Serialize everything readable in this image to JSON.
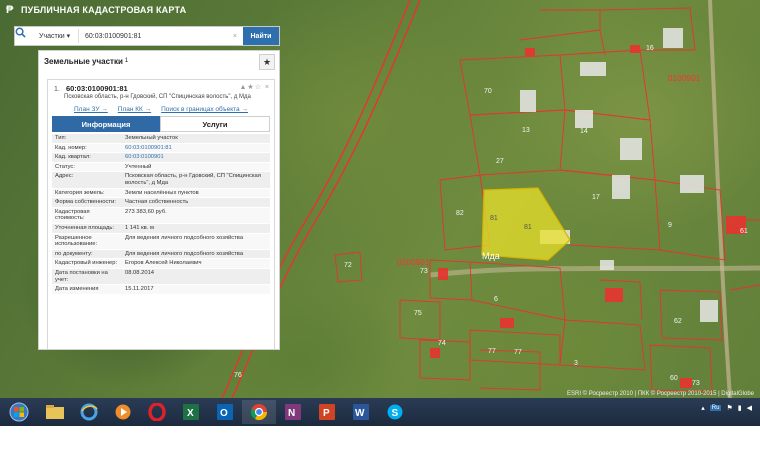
{
  "app": {
    "title": "ПУБЛИЧНАЯ КАДАСТРОВАЯ КАРТА"
  },
  "search": {
    "type_label": "Участки",
    "query": "60:03:0100901:81",
    "find_label": "Найти"
  },
  "panel": {
    "title": "Земельные участки",
    "count": "1",
    "result": {
      "index": "1.",
      "cad_number": "60:03:0100901:81",
      "address": "Псковская область, р-н Гдовский, СП \"Спицинская волость\", д Мда",
      "links": [
        "План ЗУ →",
        "План КК →",
        "Поиск в границах объекта →"
      ],
      "tabs": [
        "Информация",
        "Услуги"
      ],
      "attributes": [
        {
          "key": "Тип:",
          "value": "Земельный участок"
        },
        {
          "key": "Кад. номер:",
          "value": "60:03:0100901:81",
          "link": true
        },
        {
          "key": "Кад. квартал:",
          "value": "60:03:0100901",
          "link": true
        },
        {
          "key": "Статус:",
          "value": "Учтенный"
        },
        {
          "key": "Адрес:",
          "value": "Псковская область, р-н Гдовский, СП \"Спицинская волость\", д Мда"
        },
        {
          "key": "Категория земель:",
          "value": "Земли населённых пунктов"
        },
        {
          "key": "Форма собственности:",
          "value": "Частная собственность"
        },
        {
          "key": "Кадастровая стоимость:",
          "value": "273 383,60 руб."
        },
        {
          "key": "Уточненная площадь:",
          "value": "1 141 кв. м"
        },
        {
          "key": "Разрешенное использование:",
          "value": "Для ведения личного подсобного хозяйства"
        },
        {
          "key": "по документу:",
          "value": "Для ведения личного подсобного хозяйства"
        },
        {
          "key": "Кадастровый инженер:",
          "value": "Егоров Алексей Николаевич"
        },
        {
          "key": "Дата постановки на учет:",
          "value": "08.08.2014"
        },
        {
          "key": "Дата изменения",
          "value": "15.11.2017"
        }
      ]
    }
  },
  "map": {
    "quarter_labels": [
      "0100901",
      "0100901"
    ],
    "village": "Мда",
    "parcel_numbers": [
      "70",
      "16",
      "13",
      "14",
      "27",
      "17",
      "81",
      "82",
      "81",
      "9",
      "72",
      "73",
      "75",
      "74",
      "77",
      "77",
      "3",
      "6",
      "76",
      "60",
      "73",
      "61",
      "62"
    ],
    "credit": "ESRI © Росреестр 2010 | ПКК © Росреестр 2010-2015 | DigitalGlobe",
    "highlight_color": "#e8e02a",
    "boundary_color": "#e8332f"
  },
  "taskbar": {
    "apps": [
      "start-orb",
      "file-explorer",
      "internet-explorer",
      "media-player",
      "opera",
      "excel",
      "outlook",
      "chrome",
      "onenote",
      "powerpoint",
      "word",
      "skype"
    ],
    "language": "Ru"
  }
}
